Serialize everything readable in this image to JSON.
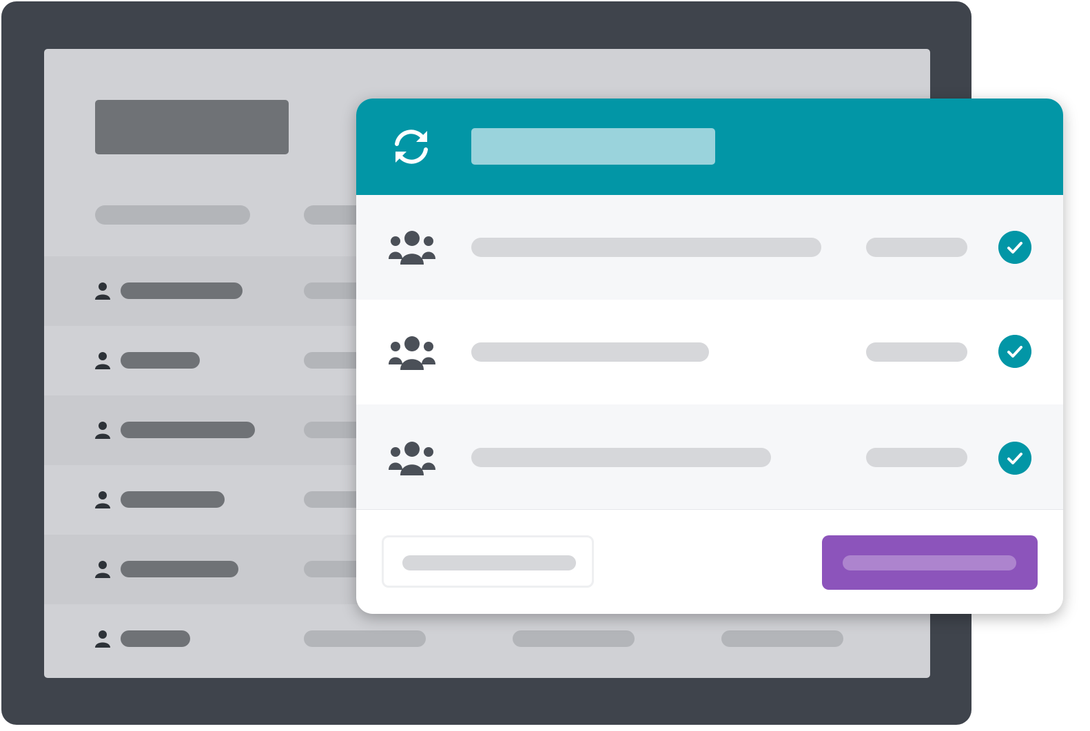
{
  "colors": {
    "device_frame": "#3f444c",
    "screen_background": "#d0d1d5",
    "placeholder_dark": "#6f7276",
    "placeholder_light": "#b3b5b9",
    "modal_header": "#0296a6",
    "header_title_placeholder": "#9ad3dc",
    "row_alt_background": "#f6f7f9",
    "modal_placeholder": "#d6d7da",
    "check_badge": "#0296a6",
    "confirm_button": "#8c54bb",
    "confirm_label_placeholder": "#ad84ce"
  },
  "icons": {
    "header": "sync-icon",
    "group": "users-group-icon",
    "user": "user-icon",
    "status": "check-circle-icon"
  },
  "background_list": {
    "rows": [
      {
        "icon": "user-icon"
      },
      {
        "icon": "user-icon"
      },
      {
        "icon": "user-icon"
      },
      {
        "icon": "user-icon"
      },
      {
        "icon": "user-icon"
      },
      {
        "icon": "user-icon"
      }
    ]
  },
  "modal": {
    "rows": [
      {
        "icon": "users-group-icon",
        "status": "check-circle-icon",
        "selected": true
      },
      {
        "icon": "users-group-icon",
        "status": "check-circle-icon",
        "selected": true
      },
      {
        "icon": "users-group-icon",
        "status": "check-circle-icon",
        "selected": true
      }
    ]
  }
}
